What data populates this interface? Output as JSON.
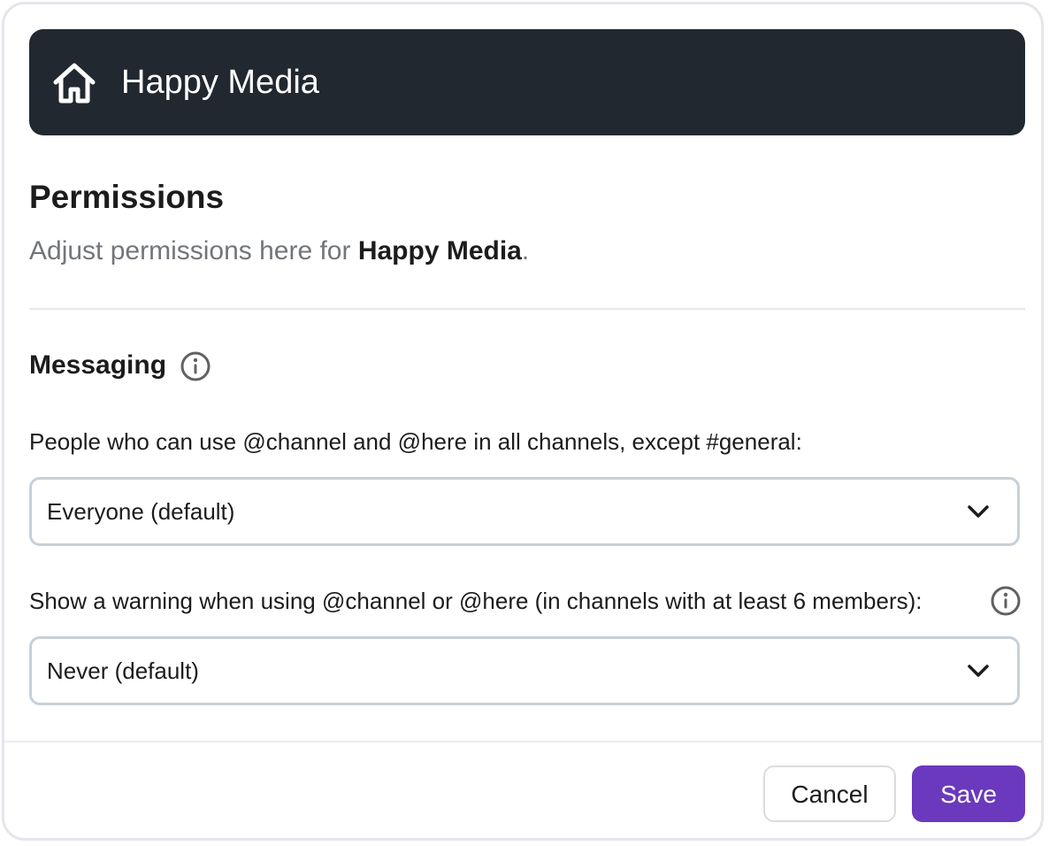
{
  "banner": {
    "icon": "house-icon",
    "title": "Happy Media"
  },
  "page": {
    "title": "Permissions",
    "subtitle_prefix": "Adjust permissions here for ",
    "subtitle_strong": "Happy Media",
    "subtitle_suffix": "."
  },
  "messaging": {
    "section_title": "Messaging",
    "info_icon": "info-icon",
    "channel_mentions": {
      "label": "People who can use @channel and @here in all channels, except #general:",
      "value": "Everyone (default)"
    },
    "mention_warning": {
      "label": "Show a warning when using @channel or @here (in channels with at least 6 members):",
      "value": "Never (default)"
    }
  },
  "footer": {
    "cancel_label": "Cancel",
    "save_label": "Save"
  },
  "colors": {
    "banner_bg": "#212830",
    "accent": "#6a39bd",
    "select_border": "#c7d0d8",
    "muted_text": "#72767a"
  }
}
